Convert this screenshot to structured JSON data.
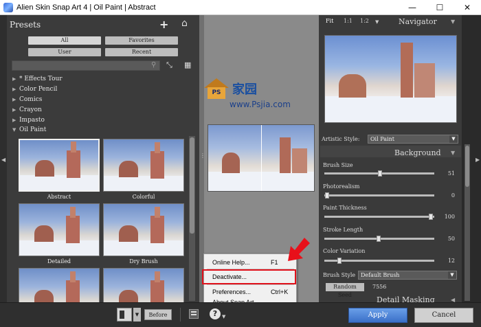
{
  "window": {
    "title": "Alien Skin Snap Art 4 | Oil Paint | Abstract",
    "minimize": "—",
    "maximize": "☐",
    "close": "✕"
  },
  "presets": {
    "title": "Presets",
    "filters": [
      "All",
      "Favorites",
      "User",
      "Recent"
    ],
    "search_value": "",
    "categories": [
      {
        "label": "* Effects Tour",
        "expanded": false
      },
      {
        "label": "Color Pencil",
        "expanded": false
      },
      {
        "label": "Comics",
        "expanded": false
      },
      {
        "label": "Crayon",
        "expanded": false
      },
      {
        "label": "Impasto",
        "expanded": false
      },
      {
        "label": "Oil Paint",
        "expanded": true
      }
    ],
    "thumbnails": [
      {
        "label": "Abstract",
        "selected": true
      },
      {
        "label": "Colorful",
        "selected": false
      },
      {
        "label": "Detailed",
        "selected": false
      },
      {
        "label": "Dry Brush",
        "selected": false
      },
      {
        "label": "",
        "selected": false
      },
      {
        "label": "",
        "selected": false
      }
    ]
  },
  "watermark": {
    "badge": "PS",
    "cn": "家园",
    "url": "www.Psjia.com"
  },
  "help_menu": {
    "items": [
      {
        "label": "Online Help...",
        "shortcut": "F1"
      },
      {
        "label": "Deactivate...",
        "shortcut": ""
      },
      {
        "label": "Preferences...",
        "shortcut": "Ctrl+K"
      },
      {
        "label": "About Snap Art...",
        "shortcut": ""
      }
    ],
    "highlight_color": "#e0101a"
  },
  "navigator": {
    "zoom": [
      "Fit",
      "1:1",
      "1:2"
    ],
    "title": "Navigator"
  },
  "settings": {
    "artistic_style_label": "Artistic Style:",
    "artistic_style_value": "Oil Paint",
    "background_title": "Background",
    "sliders": [
      {
        "label": "Brush Size",
        "value": "51",
        "fraction": 0.51
      },
      {
        "label": "Photorealism",
        "value": "0",
        "fraction": 0.0
      },
      {
        "label": "Paint Thickness",
        "value": "100",
        "fraction": 1.0
      },
      {
        "label": "Stroke Length",
        "value": "50",
        "fraction": 0.5
      },
      {
        "label": "Color Variation",
        "value": "12",
        "fraction": 0.12
      }
    ],
    "brush_style_label": "Brush Style",
    "brush_style_value": "Default Brush",
    "random_seed_label": "Random Seed",
    "random_seed_value": "7556",
    "detail_masking_title": "Detail Masking"
  },
  "bottom": {
    "before_label": "Before",
    "help_icon": "?",
    "apply_label": "Apply",
    "cancel_label": "Cancel",
    "accent": "#3a6fc8"
  }
}
